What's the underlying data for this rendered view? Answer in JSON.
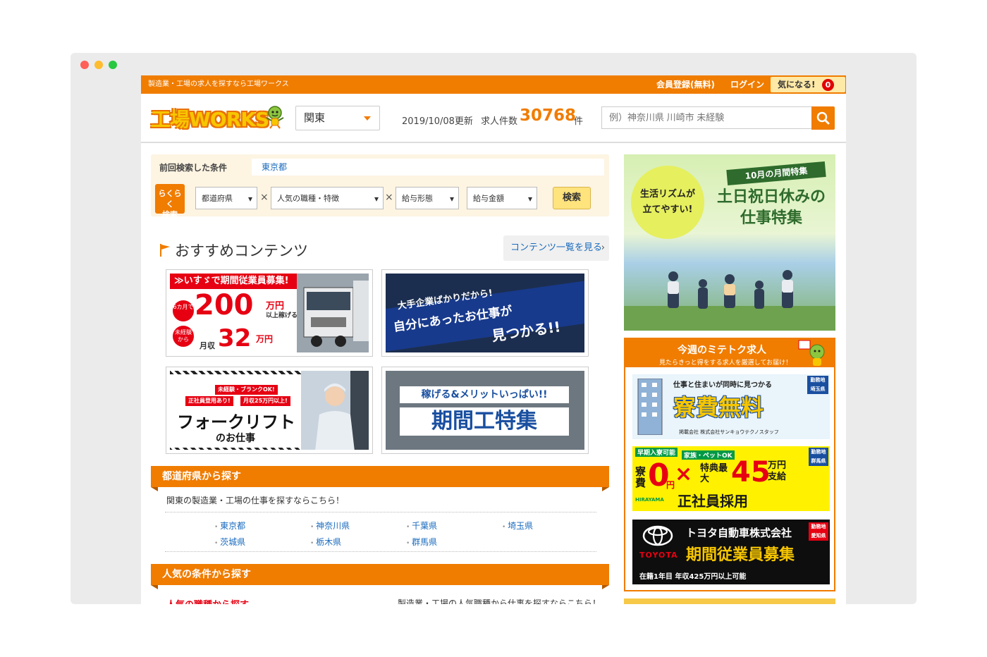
{
  "topbar": {
    "tagline": "製造業・工場の求人を探すなら工場ワークス",
    "register": "会員登録(無料)",
    "login": "ログイン",
    "favorite": "気になる!",
    "favorite_count": "0"
  },
  "header": {
    "logo": "工場WORKS",
    "region": "関東",
    "updated": "2019/10/08更新",
    "jobs_label": "求人件数",
    "jobs_count": "30768",
    "jobs_unit": "件",
    "search_placeholder": "例）神奈川県 川崎市 未経験"
  },
  "previous_search": {
    "label": "前回検索した条件",
    "value": "東京都"
  },
  "quick_search": {
    "badge_line1": "らくらく",
    "badge_line2": "検索",
    "selects": [
      "都道府県",
      "人気の職種・特徴",
      "給与形態",
      "給与金額"
    ],
    "separator": "×",
    "button": "検索"
  },
  "recommended": {
    "title": "おすすめコンテンツ",
    "more_link": "コンテンツ一覧を見る",
    "banners": {
      "isuzu": {
        "header": "≫いすゞで期間従業員募集!",
        "months": "6カ月で",
        "amount": "200",
        "amount_unit": "万円",
        "amount_note": "以上稼げる",
        "inexperienced": "未経験から",
        "monthly": "月収",
        "monthly_amount": "32",
        "monthly_unit": "万円"
      },
      "bigcorp": {
        "line1": "大手企業ばかりだから!",
        "line2": "自分にあったお仕事が",
        "line3": "見つかる!!"
      },
      "forklift": {
        "badge1": "未経験・ブランクOK!",
        "badge2": "正社員登用あり!",
        "badge3": "月収25万円以上!",
        "title": "フォークリフト",
        "subtitle": "のお仕事"
      },
      "kikanko": {
        "line1": "稼げる&メリットいっぱい!!",
        "line2": "期間工特集"
      }
    }
  },
  "prefecture_section": {
    "title": "都道府県から探す",
    "lead": "関東の製造業・工場の仕事を探すならこちら！",
    "prefectures": [
      "東京都",
      "神奈川県",
      "千葉県",
      "埼玉県",
      "茨城県",
      "栃木県",
      "群馬県"
    ]
  },
  "popular_section": {
    "title": "人気の条件から探す",
    "sub_left": "人気の職種から探す",
    "sub_right": "製造業・工場の人気職種から仕事を探すならこちら！"
  },
  "feature_banner": {
    "circle_line1": "生活リズムが",
    "circle_line2": "立てやすい!",
    "ribbon": "10月の月間特集",
    "title_line1": "土日祝日休みの",
    "title_line2": "仕事特集"
  },
  "weekly": {
    "title": "今週のミテトク求人",
    "subtitle": "見たらきっと得をする求人を厳選してお届け！",
    "banners": {
      "ryohi": {
        "line1": "仕事と住まいが同時に見つかる",
        "big": "寮費無料",
        "company": "掲載会社 株式会社サンキョウテクノスタッフ",
        "location": "勤務地 埼玉県"
      },
      "hirayama": {
        "tag1": "早期入寮可能",
        "tag2": "家族・ペットOK",
        "ryohi": "寮費",
        "zero": "0",
        "yen": "円",
        "times": "×",
        "bonus": "特典最大",
        "amount": "45",
        "unit": "万円支給",
        "seishain": "正社員採用",
        "brand": "HIRAYAMA",
        "location": "勤務地 群馬県"
      },
      "toyota": {
        "brand": "TOYOTA",
        "company": "トヨタ自動車株式会社",
        "title": "期間従業員募集",
        "note": "在籍1年目 年収425万円以上可能",
        "location": "勤務地 愛知県"
      }
    }
  }
}
